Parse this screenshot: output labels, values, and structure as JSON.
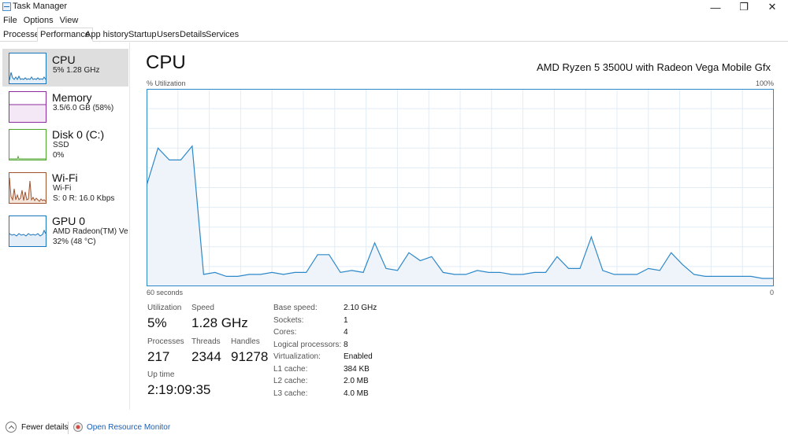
{
  "window": {
    "title": "Task Manager",
    "minimize": "—",
    "maximize": "❐",
    "close": "✕"
  },
  "menu": [
    "File",
    "Options",
    "View"
  ],
  "tabs": [
    {
      "label": "Processes",
      "active": false
    },
    {
      "label": "Performance",
      "active": true
    },
    {
      "label": "App history",
      "active": false
    },
    {
      "label": "Startup",
      "active": false
    },
    {
      "label": "Users",
      "active": false
    },
    {
      "label": "Details",
      "active": false
    },
    {
      "label": "Services",
      "active": false
    }
  ],
  "sidebar": {
    "items": [
      {
        "title": "CPU",
        "line1": "5%  1.28 GHz",
        "line2": "",
        "color": "#1b75bb"
      },
      {
        "title": "Memory",
        "line1": "3.5/6.0 GB (58%)",
        "line2": "",
        "color": "#8b2b9d"
      },
      {
        "title": "Disk 0 (C:)",
        "line1": "SSD",
        "line2": "0%",
        "color": "#4ca42e"
      },
      {
        "title": "Wi-Fi",
        "line1": "Wi-Fi",
        "line2": "S: 0  R: 16.0 Kbps",
        "color": "#a0522d"
      },
      {
        "title": "GPU 0",
        "line1": "AMD Radeon(TM) Veg...",
        "line2": "32%  (48 °C)",
        "color": "#1b75bb"
      }
    ]
  },
  "main": {
    "title": "CPU",
    "model": "AMD Ryzen 5 3500U with Radeon Vega Mobile Gfx",
    "util_label": "% Utilization",
    "util_max": "100%",
    "axis_left": "60 seconds",
    "axis_right": "0",
    "graph": {
      "line_color": "#2d88c8",
      "fill_color": "#eef4fa",
      "values": [
        51,
        70,
        64,
        64,
        71,
        6,
        7,
        5,
        5,
        6,
        6,
        7,
        6,
        7,
        7,
        16,
        16,
        7,
        8,
        7,
        22,
        9,
        8,
        17,
        13,
        15,
        7,
        6,
        6,
        8,
        7,
        7,
        6,
        6,
        7,
        7,
        15,
        9,
        9,
        25,
        8,
        6,
        6,
        6,
        9,
        8,
        17,
        11,
        6,
        5,
        5,
        5,
        5,
        5,
        4,
        4
      ]
    },
    "stats": {
      "utilization_label": "Utilization",
      "utilization": "5%",
      "speed_label": "Speed",
      "speed": "1.28 GHz",
      "processes_label": "Processes",
      "processes": "217",
      "threads_label": "Threads",
      "threads": "2344",
      "handles_label": "Handles",
      "handles": "91278",
      "uptime_label": "Up time",
      "uptime": "2:19:09:35"
    },
    "specs": [
      {
        "label": "Base speed:",
        "value": "2.10 GHz"
      },
      {
        "label": "Sockets:",
        "value": "1"
      },
      {
        "label": "Cores:",
        "value": "4"
      },
      {
        "label": "Logical processors:",
        "value": "8"
      },
      {
        "label": "Virtualization:",
        "value": "Enabled"
      },
      {
        "label": "L1 cache:",
        "value": "384 KB"
      },
      {
        "label": "L2 cache:",
        "value": "2.0 MB"
      },
      {
        "label": "L3 cache:",
        "value": "4.0 MB"
      }
    ]
  },
  "footer": {
    "fewer_details": "Fewer details",
    "open_monitor": "Open Resource Monitor"
  }
}
